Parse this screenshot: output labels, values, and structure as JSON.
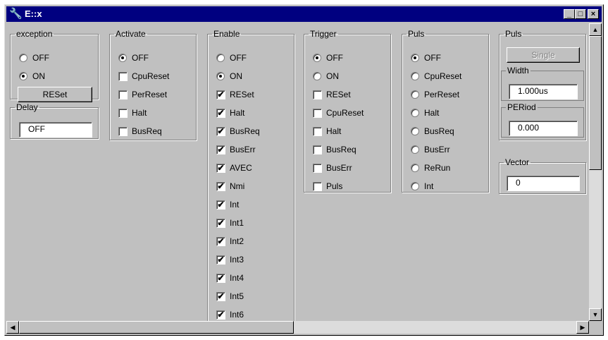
{
  "window": {
    "title": "E::x",
    "min_label": "_",
    "max_label": "□",
    "close_label": "×"
  },
  "exception": {
    "legend": "exception",
    "options": [
      "OFF",
      "ON"
    ],
    "selected": 1,
    "button": "RESet"
  },
  "delay": {
    "legend": "Delay",
    "value": "OFF"
  },
  "activate": {
    "legend": "Activate",
    "radio": "OFF",
    "checks": [
      "CpuReset",
      "PerReset",
      "Halt",
      "BusReq"
    ]
  },
  "enable": {
    "legend": "Enable",
    "radios": [
      "OFF",
      "ON"
    ],
    "selected": 1,
    "checks": [
      "RESet",
      "Halt",
      "BusReq",
      "BusErr",
      "AVEC",
      "Nmi",
      "Int",
      "Int1",
      "Int2",
      "Int3",
      "Int4",
      "Int5",
      "Int6"
    ]
  },
  "trigger": {
    "legend": "Trigger",
    "radios": [
      "OFF",
      "ON"
    ],
    "selected": 0,
    "checks": [
      "RESet",
      "CpuReset",
      "Halt",
      "BusReq",
      "BusErr",
      "Puls"
    ]
  },
  "puls": {
    "legend": "Puls",
    "options": [
      "OFF",
      "CpuReset",
      "PerReset",
      "Halt",
      "BusReq",
      "BusErr",
      "ReRun",
      "Int"
    ],
    "selected": 0
  },
  "puls2": {
    "legend": "Puls",
    "button": "Single",
    "width_legend": "Width",
    "width_value": "1.000us",
    "period_legend": "PERiod",
    "period_value": "0.000"
  },
  "vector": {
    "legend": "Vector",
    "value": "0"
  },
  "icons": {
    "title": "wrench-icon",
    "checkmark": "✔"
  }
}
